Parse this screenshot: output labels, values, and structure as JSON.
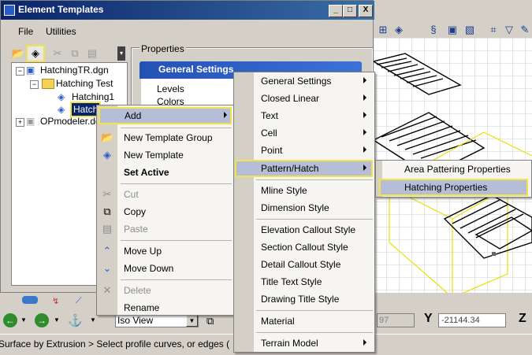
{
  "window": {
    "title": "Element Templates",
    "buttons": [
      "_",
      "□",
      "X"
    ]
  },
  "menubar": [
    "File",
    "Utilities"
  ],
  "tree": [
    {
      "label": "HatchingTR.dgn",
      "level": 0,
      "expander": "−"
    },
    {
      "label": "Hatching Test",
      "level": 1,
      "expander": "−"
    },
    {
      "label": "Hatching1",
      "level": 2
    },
    {
      "label": "Hatch",
      "level": 2,
      "selected": true
    },
    {
      "label": "OPmodeler.dg",
      "level": 0,
      "expander": "+"
    }
  ],
  "properties": {
    "label": "Properties",
    "section": "General Settings",
    "items": [
      "Levels",
      "Colors"
    ]
  },
  "context_menu": {
    "items": [
      {
        "label": "Add",
        "submenu": true,
        "highlight": true
      },
      {
        "label": "New Template Group",
        "icon": "folder-icon"
      },
      {
        "label": "New Template",
        "icon": "template-icon"
      },
      {
        "label": "Set Active",
        "bold": true
      },
      {
        "label": "Cut",
        "disabled": true,
        "icon": "scissors-icon"
      },
      {
        "label": "Copy",
        "icon": "copy-icon"
      },
      {
        "label": "Paste",
        "disabled": true,
        "icon": "paste-icon"
      },
      {
        "label": "Move Up",
        "icon": "up-icon"
      },
      {
        "label": "Move Down",
        "icon": "down-icon"
      },
      {
        "label": "Delete",
        "disabled": true,
        "icon": "delete-icon"
      },
      {
        "label": "Rename"
      }
    ]
  },
  "add_submenu": {
    "items": [
      {
        "label": "General Settings",
        "submenu": true
      },
      {
        "label": "Closed Linear",
        "submenu": true
      },
      {
        "label": "Text",
        "submenu": true
      },
      {
        "label": "Cell",
        "submenu": true
      },
      {
        "label": "Point",
        "submenu": true
      },
      {
        "label": "Pattern/Hatch",
        "submenu": true,
        "highlight": true
      },
      {
        "label": "Mline Style"
      },
      {
        "label": "Dimension Style"
      },
      {
        "label": "Elevation Callout Style"
      },
      {
        "label": "Section Callout Style"
      },
      {
        "label": "Detail Callout Style"
      },
      {
        "label": "Title Text Style"
      },
      {
        "label": "Drawing Title Style"
      },
      {
        "label": "Material"
      },
      {
        "label": "Terrain Model",
        "submenu": true
      }
    ]
  },
  "pattern_submenu": {
    "items": [
      {
        "label": "Area Pattering Properties"
      },
      {
        "label": "Hatching Properties",
        "highlight": true
      }
    ]
  },
  "nav": {
    "view_select": "Iso View",
    "x_value": "97",
    "y_label": "Y",
    "y_value": "-21144.34",
    "z_label": "Z"
  },
  "status": "Surface by Extrusion > Select profile curves, or edges (",
  "colors": {
    "highlight_outline": "#f0e44a",
    "menu_highlight": "#b5bed6",
    "title_blue": "#0a246a",
    "hatch_yellow": "#e8e000"
  }
}
